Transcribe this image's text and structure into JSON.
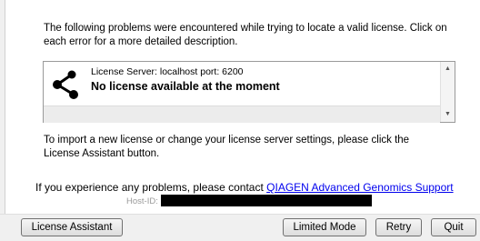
{
  "intro_text": "The following problems were encountered while trying to locate a valid license. Click on each error for a more detailed description.",
  "errors": [
    {
      "icon": "network-share-icon",
      "server_label": "License Server: localhost port: 6200",
      "title": "No license available at the moment"
    }
  ],
  "import_text": "To import a new license or change your license server settings, please click the License Assistant button.",
  "problems": {
    "prefix": "If you experience any problems, please contact ",
    "link_text": "QIAGEN Advanced Genomics Support"
  },
  "host": {
    "label": "Host-ID:"
  },
  "buttons": {
    "license_assistant": "License Assistant",
    "limited_mode": "Limited Mode",
    "retry": "Retry",
    "quit": "Quit"
  },
  "colors": {
    "link": "#0000ee",
    "host_label": "#9a9a9a",
    "redaction": "#000000"
  }
}
